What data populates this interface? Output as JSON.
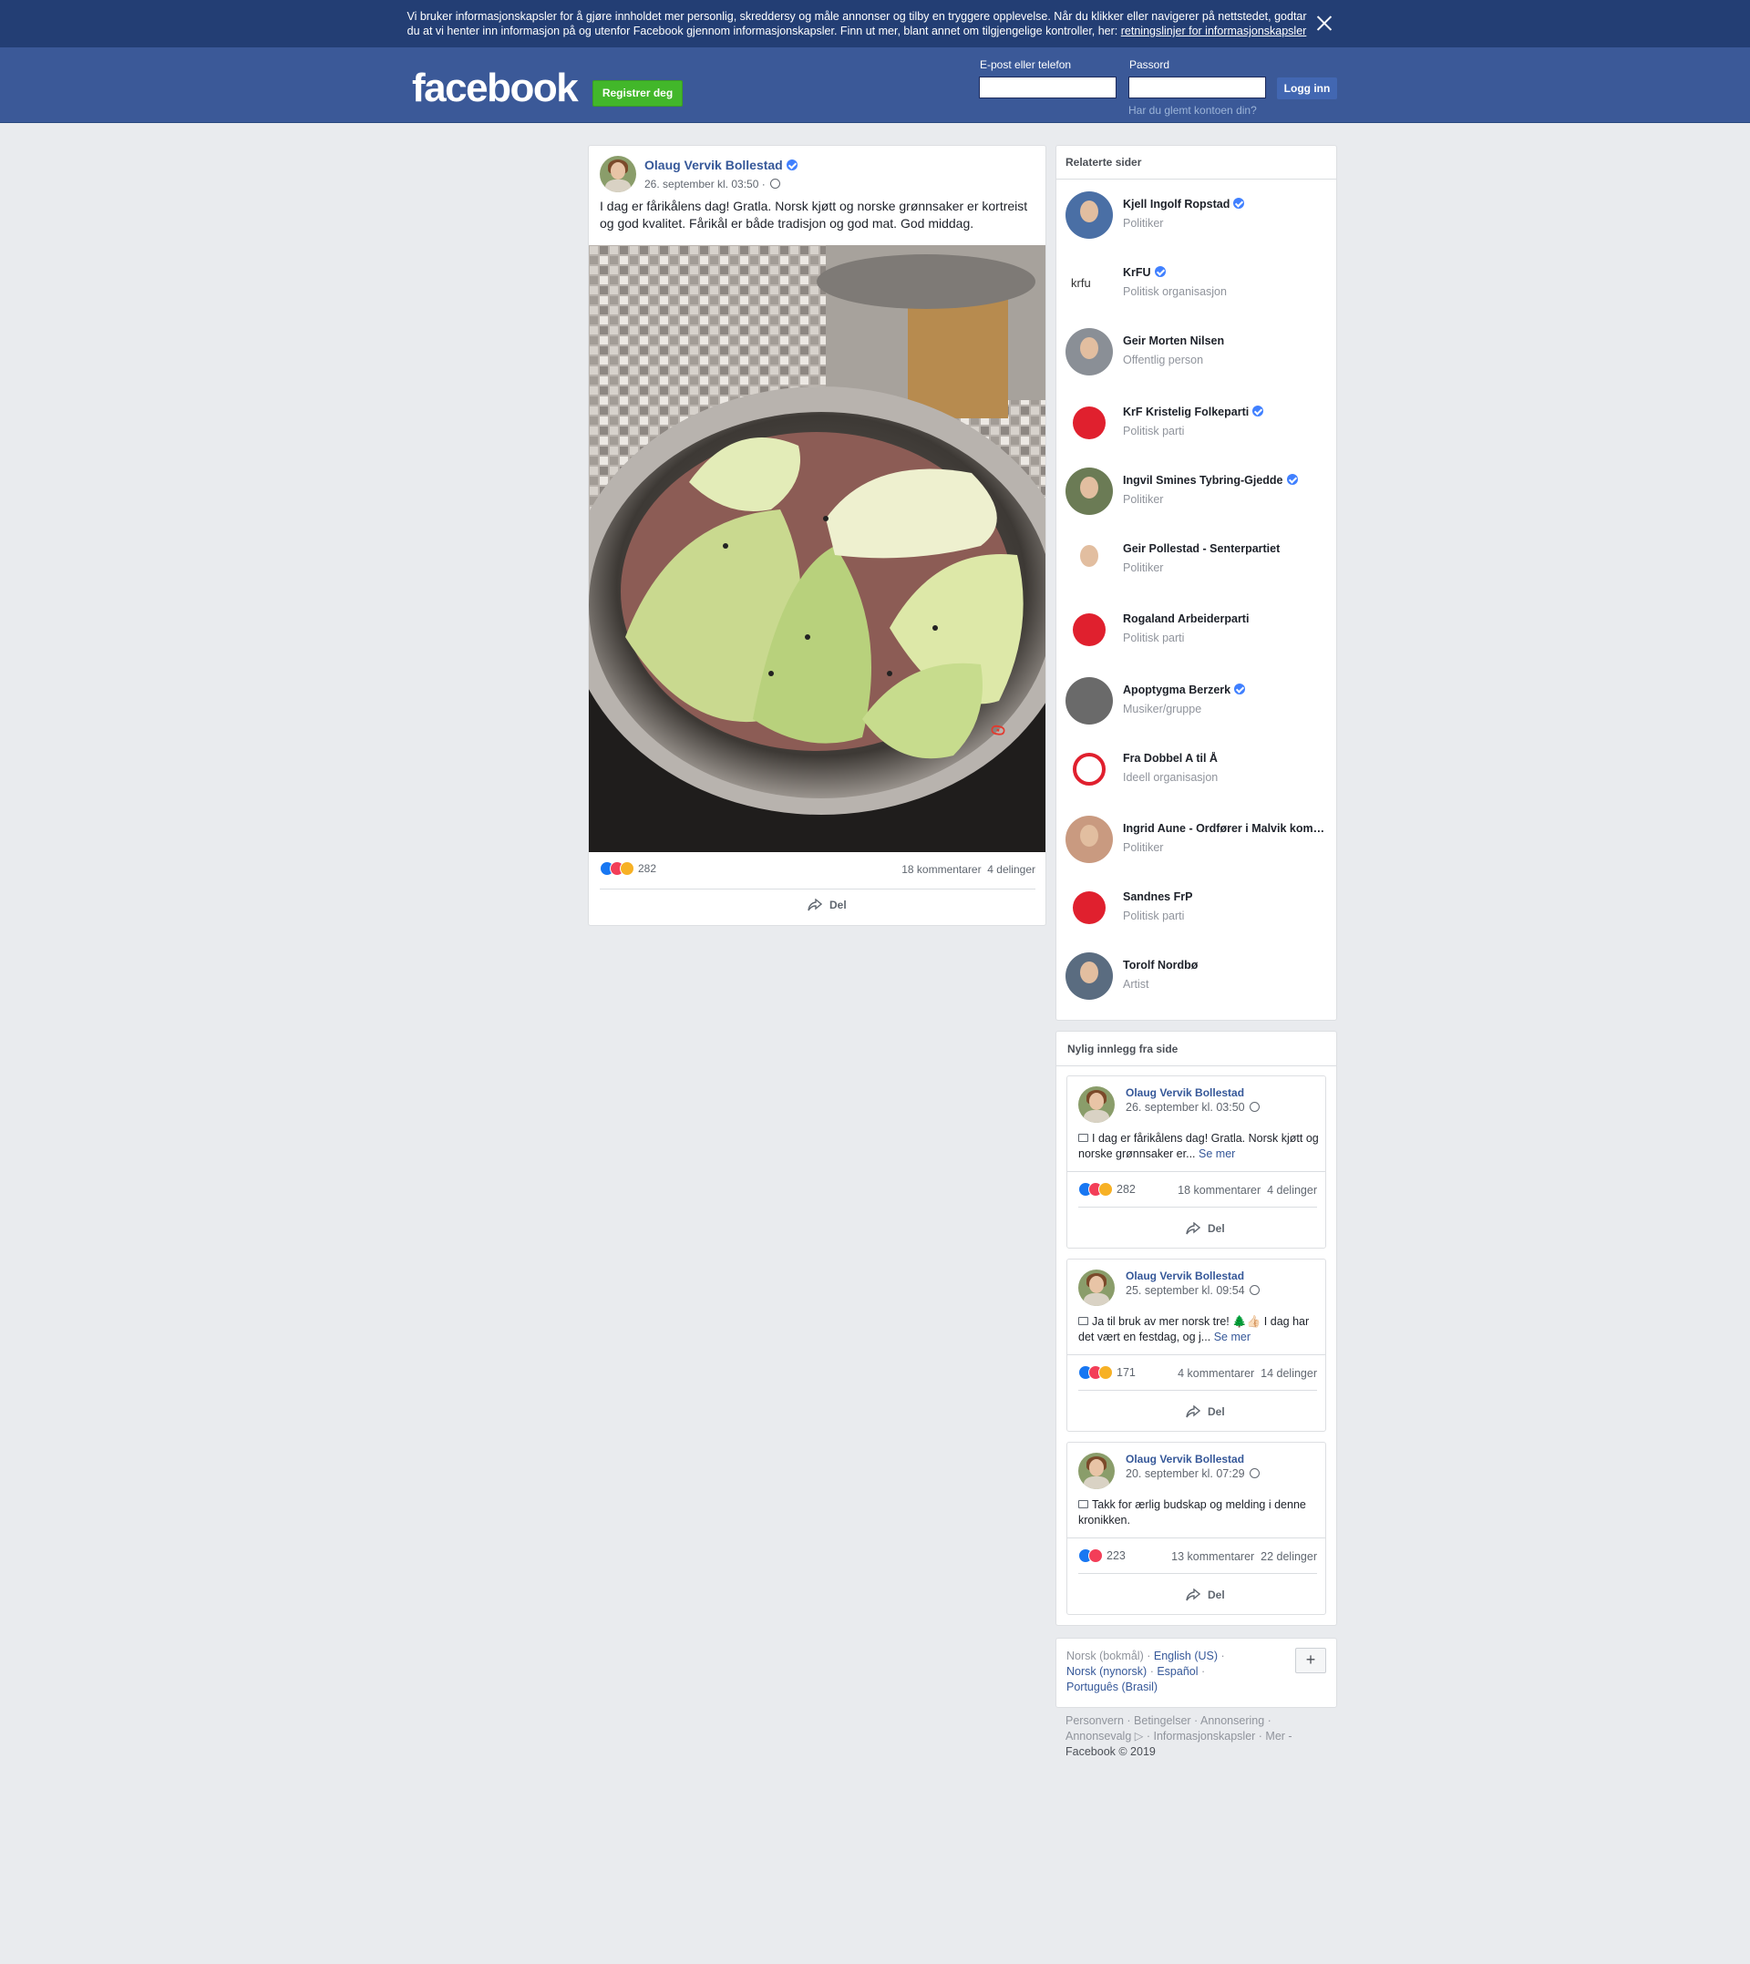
{
  "cookie_banner": {
    "text": "Vi bruker informasjonskapsler for å gjøre innholdet mer personlig, skreddersy og måle annonser og tilby en tryggere opplevelse. Når du klikker eller navigerer på nettstedet, godtar du at vi henter inn informasjon på og utenfor Facebook gjennom informasjonskapsler. Finn ut mer, blant annet om tilgjengelige kontroller, her:",
    "link": "retningslinjer for informasjonskapsler"
  },
  "header": {
    "logo": "facebook",
    "register": "Registrer deg",
    "email_label": "E-post eller telefon",
    "password_label": "Passord",
    "login": "Logg inn",
    "forgot": "Har du glemt kontoen din?"
  },
  "post": {
    "author": "Olaug Vervik Bollestad",
    "time": "26. september kl. 03:50 ·",
    "text": "I dag er fårikålens dag! Gratla. Norsk kjøtt og norske grønnsaker er kortreist og god kvalitet. Fårikål er både tradisjon og god mat. God middag.",
    "reactions": "282",
    "comments": "18 kommentarer",
    "shares": "4 delinger",
    "share_label": "Del"
  },
  "related": {
    "title": "Relaterte sider",
    "items": [
      {
        "name": "Kjell Ingolf Ropstad",
        "category": "Politiker",
        "verified": true
      },
      {
        "name": "KrFU",
        "category": "Politisk organisasjon",
        "verified": true
      },
      {
        "name": "Geir Morten Nilsen",
        "category": "Offentlig person",
        "verified": false
      },
      {
        "name": "KrF Kristelig Folkeparti",
        "category": "Politisk parti",
        "verified": true
      },
      {
        "name": "Ingvil Smines Tybring-Gjedde",
        "category": "Politiker",
        "verified": true
      },
      {
        "name": "Geir Pollestad - Senterpartiet",
        "category": "Politiker",
        "verified": false
      },
      {
        "name": "Rogaland Arbeiderparti",
        "category": "Politisk parti",
        "verified": false
      },
      {
        "name": "Apoptygma Berzerk",
        "category": "Musiker/gruppe",
        "verified": true
      },
      {
        "name": "Fra Dobbel A til Å",
        "category": "Ideell organisasjon",
        "verified": false
      },
      {
        "name": "Ingrid Aune - Ordfører i Malvik kommune",
        "category": "Politiker",
        "verified": false
      },
      {
        "name": "Sandnes FrP",
        "category": "Politisk parti",
        "verified": false
      },
      {
        "name": "Torolf Nordbø",
        "category": "Artist",
        "verified": false
      }
    ]
  },
  "recent": {
    "title": "Nylig innlegg fra side",
    "posts": [
      {
        "author": "Olaug Vervik Bollestad",
        "time": "26. september kl. 03:50",
        "text": "I dag er fårikålens dag! Gratla. Norsk kjøtt og norske grønnsaker er...",
        "more": "Se mer",
        "reactions": "282",
        "comments": "18 kommentarer",
        "shares": "4 delinger",
        "share_label": "Del"
      },
      {
        "author": "Olaug Vervik Bollestad",
        "time": "25. september kl. 09:54",
        "text": "Ja til bruk av mer norsk tre! 🌲👍🏻 I dag har det vært en festdag, og j...",
        "more": "Se mer",
        "reactions": "171",
        "comments": "4 kommentarer",
        "shares": "14 delinger",
        "share_label": "Del"
      },
      {
        "author": "Olaug Vervik Bollestad",
        "time": "20. september kl. 07:29",
        "text": "Takk for ærlig budskap og melding i denne kronikken.",
        "more": "",
        "reactions": "223",
        "comments": "13 kommentarer",
        "shares": "22 delinger",
        "share_label": "Del"
      }
    ]
  },
  "languages": {
    "current": "Norsk (bokmål) ·",
    "options": [
      "English (US)",
      "Norsk (nynorsk)",
      "Español",
      "Português (Brasil)"
    ],
    "plus": "+"
  },
  "footer": {
    "links": "Personvern · Betingelser · Annonsering · Annonsevalg ▷ · Informasjonskapsler · Mer -",
    "copyright": "Facebook © 2019"
  },
  "colors": {
    "brand_blue": "#3b5998",
    "banner_blue": "#233e74",
    "register_green": "#42b72a",
    "link_blue": "#365899",
    "page_bg": "#e9ebee"
  }
}
